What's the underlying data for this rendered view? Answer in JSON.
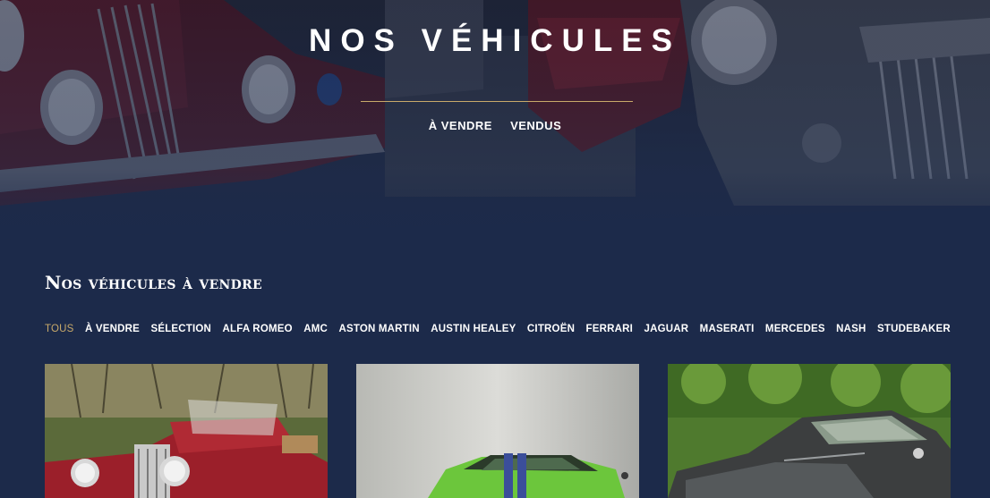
{
  "hero": {
    "title": "NOS VÉHICULES",
    "nav": [
      "À VENDRE",
      "VENDUS"
    ]
  },
  "section": {
    "title": "Nos véhicules à vendre"
  },
  "filters": {
    "active": "TOUS",
    "items": [
      "TOUS",
      "À VENDRE",
      "SÉLECTION",
      "ALFA ROMEO",
      "AMC",
      "ASTON MARTIN",
      "AUSTIN HEALEY",
      "CITROËN",
      "FERRARI",
      "JAGUAR",
      "MASERATI",
      "MERCEDES",
      "NASH",
      "STUDEBAKER"
    ]
  },
  "cards": [
    {
      "alt": "red-vintage-roadster-photo"
    },
    {
      "alt": "green-muscle-car-photo"
    },
    {
      "alt": "grey-vintage-coupe-photo"
    }
  ],
  "colors": {
    "background": "#1c2a4a",
    "accent": "#c8a96a"
  }
}
